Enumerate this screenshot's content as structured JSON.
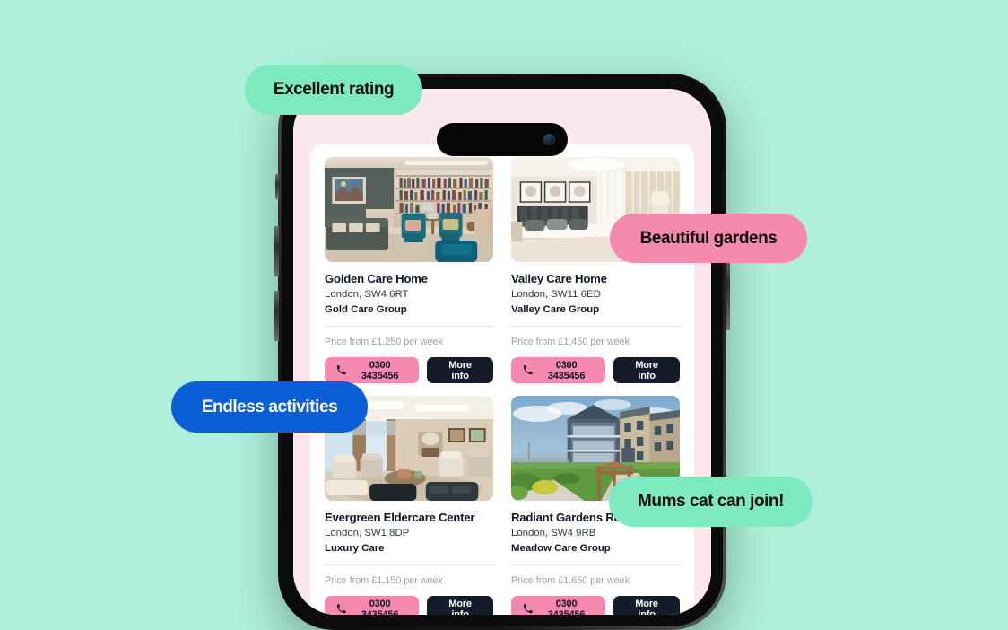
{
  "theme": {
    "background": "#ADEFDA",
    "app_background": "#FCE9F0",
    "sheet_background": "#FFFFFF",
    "pink_accent": "#F589AF",
    "dark_accent": "#141B2B",
    "mint_accent": "#7DE9BF",
    "blue_accent": "#0B5FD6",
    "muted_text": "#9AA1AB"
  },
  "pills": [
    {
      "id": "rating",
      "label": "Excellent rating",
      "color": "#7DE9BF",
      "text_color": "#0B0B0D"
    },
    {
      "id": "gardens",
      "label": "Beautiful gardens",
      "color": "#F589AF",
      "text_color": "#0B0B0D"
    },
    {
      "id": "activities",
      "label": "Endless activities",
      "color": "#0B5FD6",
      "text_color": "#FFFFFF"
    },
    {
      "id": "cat",
      "label": "Mums cat can join!",
      "color": "#7DE9BF",
      "text_color": "#0B0B0D"
    }
  ],
  "cards": [
    {
      "title": "Golden Care Home",
      "location": "London, SW4 6RT",
      "group": "Gold Care Group",
      "price": "Price from £1,250 per week",
      "phone": "0300 3435456",
      "more_info": "More info",
      "photo": "care-home-library-lounge"
    },
    {
      "title": "Valley Care Home",
      "location": "London, SW11 6ED",
      "group": "Valley Care Group",
      "price": "Price from £1,450 per week",
      "phone": "0300 3435456",
      "more_info": "More info",
      "photo": "care-home-bedroom"
    },
    {
      "title": "Evergreen Eldercare Center",
      "location": "London, SW1 8DP",
      "group": "Luxury Care",
      "price": "Price from £1,150 per week",
      "phone": "0300 3435456",
      "more_info": "More info",
      "photo": "care-home-bright-lounge"
    },
    {
      "title": "Radiant Gardens Res",
      "location": "London, SW4 9RB",
      "group": "Meadow Care Group",
      "price": "Price from £1,650 per week",
      "phone": "0300 3435456",
      "more_info": "More info",
      "photo": "care-home-exterior-garden"
    }
  ],
  "device": {
    "type": "smartphone",
    "notch": "dynamic-island",
    "camera": "front-camera"
  }
}
